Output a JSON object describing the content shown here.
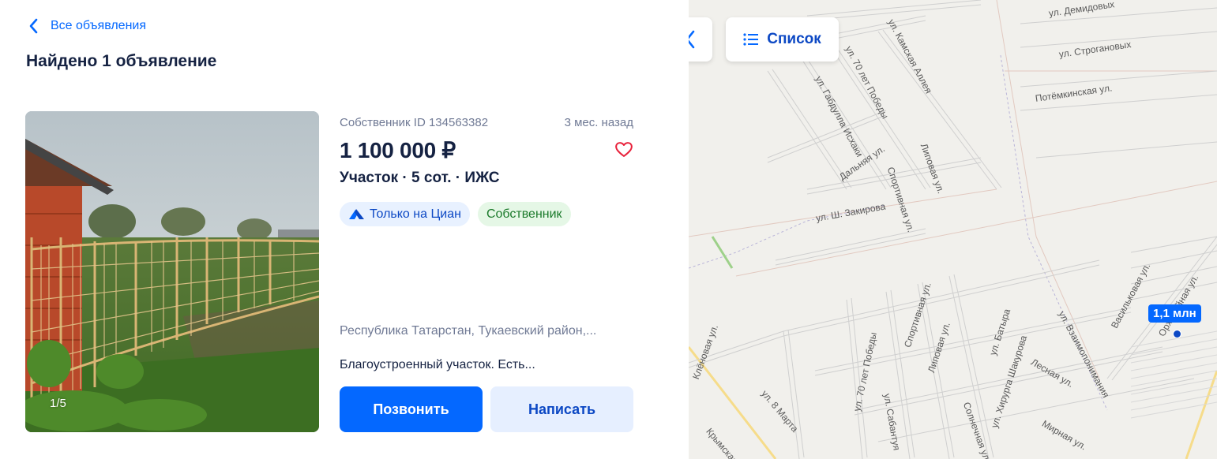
{
  "nav": {
    "back_label": "Все объявления"
  },
  "results": {
    "title": "Найдено 1 объявление"
  },
  "listing": {
    "owner_id": "Собственник ID 134563382",
    "date": "3 мес. назад",
    "price": "1 100 000 ₽",
    "subtitle": "Участок · 5 сот. · ИЖС",
    "badges": {
      "cian": "Только на Циан",
      "owner": "Собственник"
    },
    "address": "Республика Татарстан, Тукаевский район,...",
    "description": "Благоустроенный участок. Есть...",
    "photo_counter": "1/5",
    "call_label": "Позвонить",
    "write_label": "Написать"
  },
  "map": {
    "list_label": "Список",
    "pin_label": "1,1 млн",
    "streets": [
      "ул. Демидовых",
      "ул. Строгановых",
      "Потёмкинская ул.",
      "ул. Камская Аллея",
      "ул. 70 лет Победы",
      "ул. Габдулла Исхаки",
      "Дальняя ул.",
      "Липовая ул.",
      "Спортивная ул.",
      "ул. Ш. Закирова",
      "Васильковая ул.",
      "ул. Взаимопонимания",
      "Спортивная ул.",
      "Липовая ул.",
      "ул. Батыра",
      "ул. Хирурга Шакурова",
      "Лесная ул.",
      "Мирная ул.",
      "ул. 70 лет Победы",
      "ул. 8 Марта",
      "ул. Сабантуя",
      "Орхидейная ул.",
      "Солнечная ул.",
      "Крымская ул.",
      "Клёновая ул."
    ]
  },
  "colors": {
    "accent": "#0468ff",
    "text": "#152242",
    "muted": "#707a95",
    "heart": "#e8203a"
  }
}
